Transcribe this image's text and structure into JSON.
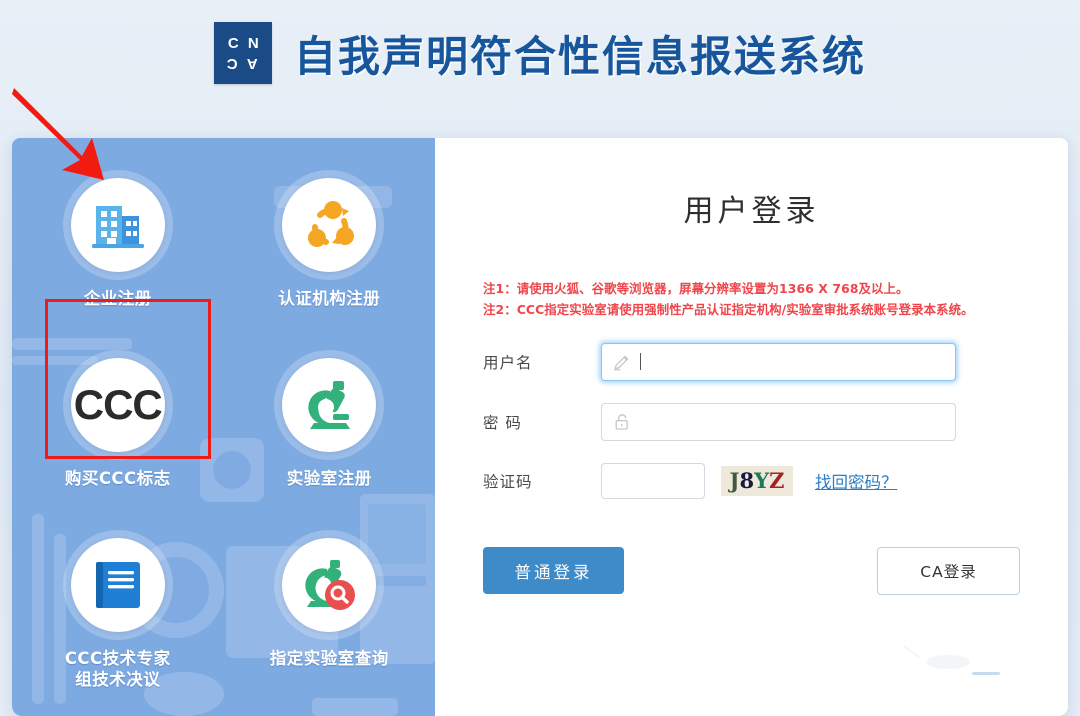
{
  "header": {
    "logo_text_top": "CN",
    "logo_text_bottom": "CA",
    "logo_letters": [
      "C",
      "N",
      "C",
      "A"
    ],
    "title": "自我声明符合性信息报送系统",
    "brand_color": "#17569c",
    "logo_bg_color": "#1b4b86"
  },
  "nav_panel": {
    "background_color": "#7eaae2",
    "tiles": [
      {
        "label": "企业注册",
        "icon": "building-icon"
      },
      {
        "label": "认证机构注册",
        "icon": "network-nodes-icon"
      },
      {
        "label": "购买CCC标志",
        "icon": "ccc-mark-icon",
        "icon_text": "CCC"
      },
      {
        "label": "实验室注册",
        "icon": "microscope-icon"
      },
      {
        "label": "CCC技术专家\n组技术决议",
        "icon": "blue-book-icon"
      },
      {
        "label": "指定实验室查询",
        "icon": "microscope-search-icon"
      }
    ]
  },
  "annotation": {
    "highlight_color": "#ee1b18",
    "arrow_color": "#f21b12",
    "highlighted_tile": "企业注册"
  },
  "login": {
    "heading": "用户登录",
    "notices": [
      "注1：请使用火狐、谷歌等浏览器，屏幕分辨率设置为1366 X 768及以上。",
      "注2：CCC指定实验室请使用强制性产品认证指定机构/实验室审批系统账号登录本系统。"
    ],
    "notice_color": "#f0454a",
    "username": {
      "label": "用户名",
      "value": "",
      "placeholder": "",
      "icon": "pencil-icon",
      "focused": true
    },
    "password": {
      "label": "密 码",
      "value": "",
      "placeholder": "",
      "icon": "lock-icon"
    },
    "captcha": {
      "label": "验证码",
      "value": "",
      "placeholder": "",
      "image_text": "J8YZ",
      "image_chars": [
        "J",
        "8",
        "Y",
        "Z"
      ]
    },
    "forgot_password_label": "找回密码？",
    "primary_button_label": "普通登录",
    "primary_button_color": "#3d8bc9",
    "ca_button_label": "CA登录"
  }
}
